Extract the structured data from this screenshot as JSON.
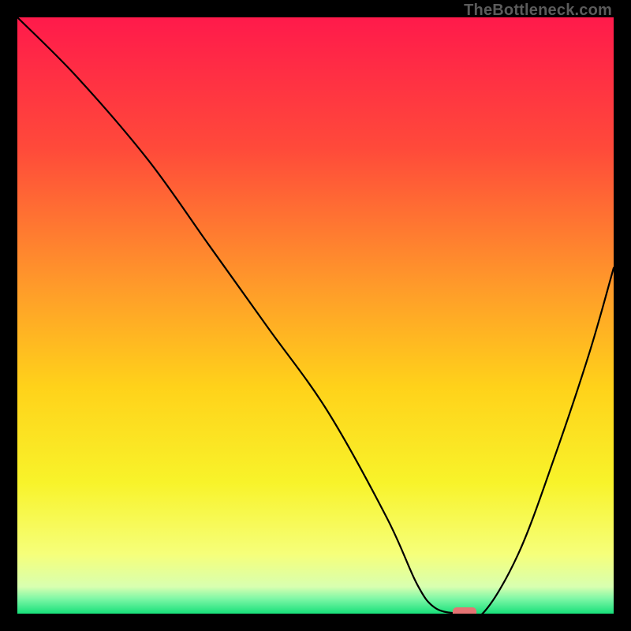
{
  "watermark": "TheBottleneck.com",
  "chart_data": {
    "type": "line",
    "title": "",
    "xlabel": "",
    "ylabel": "",
    "xlim": [
      0,
      100
    ],
    "ylim": [
      0,
      100
    ],
    "gradient_stops": [
      {
        "pct": 0.0,
        "color": "#ff1a4b"
      },
      {
        "pct": 0.22,
        "color": "#ff4a3a"
      },
      {
        "pct": 0.45,
        "color": "#ff9a2a"
      },
      {
        "pct": 0.62,
        "color": "#ffd21a"
      },
      {
        "pct": 0.78,
        "color": "#f8f32a"
      },
      {
        "pct": 0.9,
        "color": "#f6ff7a"
      },
      {
        "pct": 0.955,
        "color": "#d8ffb0"
      },
      {
        "pct": 0.975,
        "color": "#7ef7a6"
      },
      {
        "pct": 1.0,
        "color": "#17e07a"
      }
    ],
    "series": [
      {
        "name": "bottleneck-curve",
        "x": [
          0,
          10,
          22,
          32,
          42,
          52,
          62,
          67,
          70,
          74,
          78,
          84,
          90,
          96,
          100
        ],
        "y": [
          100,
          90,
          76,
          62,
          48,
          34,
          16,
          5,
          1,
          0,
          0,
          10,
          26,
          44,
          58
        ]
      }
    ],
    "marker": {
      "name": "optimal-point",
      "x_start": 73,
      "x_end": 77,
      "y": 0,
      "color": "#e57373"
    }
  }
}
